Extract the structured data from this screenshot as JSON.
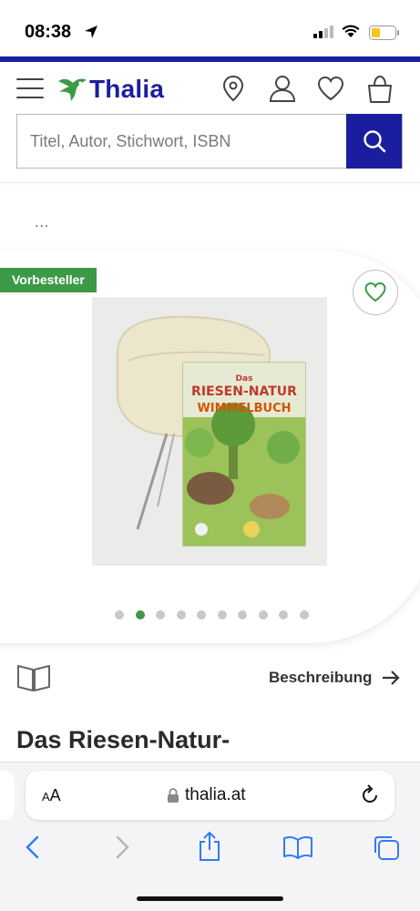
{
  "status_bar": {
    "time": "08:38"
  },
  "header": {
    "logo_text": "Thalia"
  },
  "search": {
    "placeholder": "Titel, Autor, Stichwort, ISBN"
  },
  "breadcrumb": {
    "text": "..."
  },
  "product": {
    "badge": "Vorbesteller",
    "cover_title_line1": "Das",
    "cover_title_line2": "RIESEN-NATUR",
    "cover_title_line3": "WIMMELBUCH",
    "image_count": 10,
    "active_image": 2,
    "description_link": "Beschreibung",
    "title": "Das Riesen-Natur-"
  },
  "browser": {
    "aa_label_small": "A",
    "aa_label_large": "A",
    "url": "thalia.at"
  },
  "colors": {
    "brand_blue": "#1a1e9e",
    "accent_green": "#3c9a46",
    "ios_blue": "#2f7cf6"
  },
  "icons": {
    "header": [
      "menu-icon",
      "thalia-logo-icon",
      "location-pin-icon",
      "user-icon",
      "heart-icon",
      "shopping-bag-icon"
    ],
    "search": "search-icon",
    "toolbar": [
      "back-icon",
      "forward-icon",
      "share-icon",
      "bookmarks-icon",
      "tabs-icon"
    ]
  }
}
